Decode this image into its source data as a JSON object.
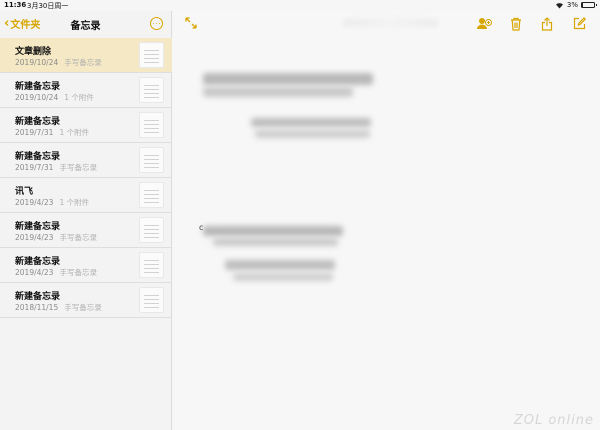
{
  "status_bar": {
    "time": "11:36",
    "date": "3月30日周一",
    "battery": "3%",
    "battery_level": 0.03
  },
  "sidebar": {
    "back_label": "文件夹",
    "title": "备忘录",
    "notes": [
      {
        "title": "文章删除",
        "date": "2019/10/24",
        "preview": "手写备忘录",
        "selected": true
      },
      {
        "title": "新建备忘录",
        "date": "2019/10/24",
        "preview": "1 个附件",
        "selected": false
      },
      {
        "title": "新建备忘录",
        "date": "2019/7/31",
        "preview": "1 个附件",
        "selected": false
      },
      {
        "title": "新建备忘录",
        "date": "2019/7/31",
        "preview": "手写备忘录",
        "selected": false
      },
      {
        "title": "讯飞",
        "date": "2019/4/23",
        "preview": "1 个附件",
        "selected": false
      },
      {
        "title": "新建备忘录",
        "date": "2019/4/23",
        "preview": "手写备忘录",
        "selected": false
      },
      {
        "title": "新建备忘录",
        "date": "2019/4/23",
        "preview": "手写备忘录",
        "selected": false
      },
      {
        "title": "新建备忘录",
        "date": "2018/11/15",
        "preview": "手写备忘录",
        "selected": false
      }
    ]
  },
  "toolbar": {
    "icons": [
      "expand-icon",
      "add-people-icon",
      "trash-icon",
      "share-icon",
      "compose-icon"
    ]
  },
  "colors": {
    "accent": "#d8a600",
    "selected_row": "#f5e8c4"
  },
  "watermark": "ZOL online"
}
